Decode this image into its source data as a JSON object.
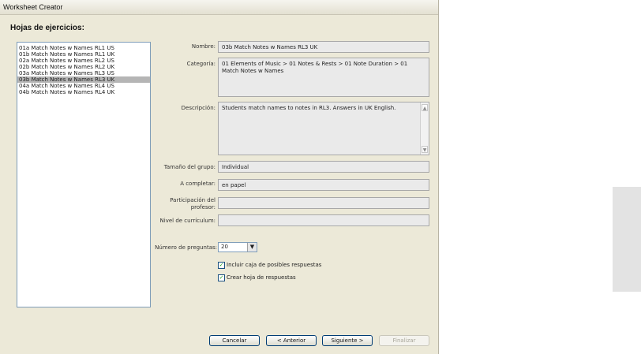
{
  "window": {
    "title": "Worksheet Creator"
  },
  "section_title": "Hojas de ejercicios:",
  "worksheets": [
    "01a Match Notes w Names RL1 US",
    "01b Match Notes w Names RL1 UK",
    "02a Match Notes w Names RL2 US",
    "02b Match Notes w Names RL2 UK",
    "03a Match Notes w Names RL3 US",
    "03b Match Notes w Names RL3 UK",
    "04a Match Notes w Names RL4 US",
    "04b Match Notes w Names RL4 UK"
  ],
  "selected_index": 5,
  "fields": {
    "nombre": {
      "label": "Nombre:",
      "value": "03b Match Notes w Names RL3 UK"
    },
    "categoria": {
      "label": "Categoría:",
      "value": "01 Elements of Music > 01 Notes & Rests > 01 Note Duration > 01 Match Notes w Names"
    },
    "descripcion": {
      "label": "Descripción:",
      "value": "Students match names to notes in RL3. Answers in UK English."
    },
    "tamano": {
      "label": "Tamaño del grupo:",
      "value": "Individual"
    },
    "completar": {
      "label": "A completar:",
      "value": "en papel"
    },
    "participacion": {
      "label": "Participación del profesor:",
      "value": ""
    },
    "nivel": {
      "label": "Nivel de currículum:",
      "value": ""
    }
  },
  "preguntas": {
    "label": "Número de preguntas:",
    "value": "20"
  },
  "checkboxes": [
    {
      "label": "Incluir caja de posibles respuestas",
      "checked": true
    },
    {
      "label": "Crear hoja de respuestas",
      "checked": true
    }
  ],
  "buttons": {
    "cancelar": "Cancelar",
    "anterior": "< Anterior",
    "siguiente": "Siguiente >",
    "finalizar": "Finalizar"
  }
}
